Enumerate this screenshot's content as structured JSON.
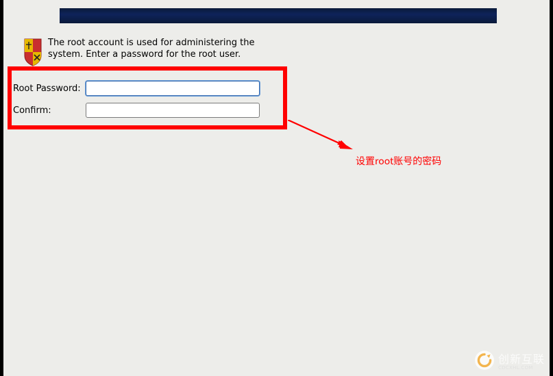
{
  "description": "The root account is used for administering the system.  Enter a password for the root user.",
  "form": {
    "password_label": "Root Password:",
    "confirm_label": "Confirm:",
    "password_value": "",
    "confirm_value": ""
  },
  "annotation": {
    "text": "设置root账号的密码"
  },
  "watermark": {
    "brand": "创新互联",
    "sub": "CDCXHL.COM"
  },
  "colors": {
    "highlight": "#ff0000",
    "header_gradient_top": "#0a1a3a",
    "header_gradient_mid": "#0e235a",
    "panel_bg": "#ededea"
  }
}
